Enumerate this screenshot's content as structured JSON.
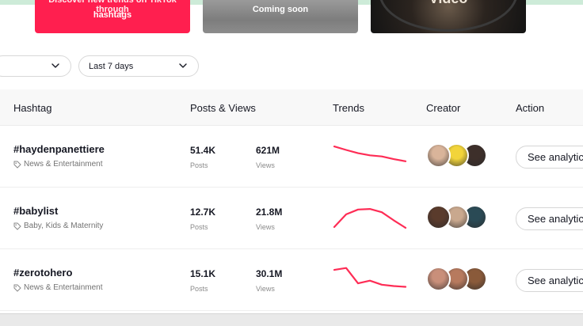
{
  "cards": {
    "red": {
      "line1": "Discover new trends on TikTok through",
      "line2": "hashtags"
    },
    "grey": {
      "text": "Coming soon"
    },
    "dark": {
      "text": "Video"
    }
  },
  "filters": {
    "first": {
      "value": ""
    },
    "period": {
      "value": "Last 7 days"
    }
  },
  "table": {
    "columns": {
      "hashtag": "Hashtag",
      "posts_views": "Posts & Views",
      "trends": "Trends",
      "creator": "Creator",
      "action": "Action"
    },
    "rows": [
      {
        "hashtag": "#haydenpanettiere",
        "category": "News & Entertainment",
        "posts": "51.4K",
        "posts_label": "Posts",
        "views": "621M",
        "views_label": "Views",
        "action": "See analytics",
        "trend": [
          0.85,
          0.72,
          0.6,
          0.52,
          0.48,
          0.38,
          0.3
        ],
        "avatars": [
          "#d9b49a",
          "#f2d43a",
          "#3d2f2a"
        ]
      },
      {
        "hashtag": "#babylist",
        "category": "Baby, Kids & Maternity",
        "posts": "12.7K",
        "posts_label": "Posts",
        "views": "21.8M",
        "views_label": "Views",
        "action": "See analytics",
        "trend": [
          0.15,
          0.62,
          0.8,
          0.82,
          0.7,
          0.4,
          0.12
        ],
        "avatars": [
          "#5a3b2c",
          "#c9a88e",
          "#2a4a55"
        ]
      },
      {
        "hashtag": "#zerotohero",
        "category": "News & Entertainment",
        "posts": "15.1K",
        "posts_label": "Posts",
        "views": "30.1M",
        "views_label": "Views",
        "action": "See analytics",
        "trend": [
          0.85,
          0.92,
          0.35,
          0.45,
          0.3,
          0.25,
          0.22
        ],
        "avatars": [
          "#c98f7a",
          "#b77a5e",
          "#8a5a3a"
        ]
      }
    ]
  },
  "colors": {
    "accent": "#fe2c55",
    "trend_line": "#fe2c55"
  },
  "icons": {
    "tag": "tag-icon",
    "chevron": "chevron-down-icon"
  }
}
